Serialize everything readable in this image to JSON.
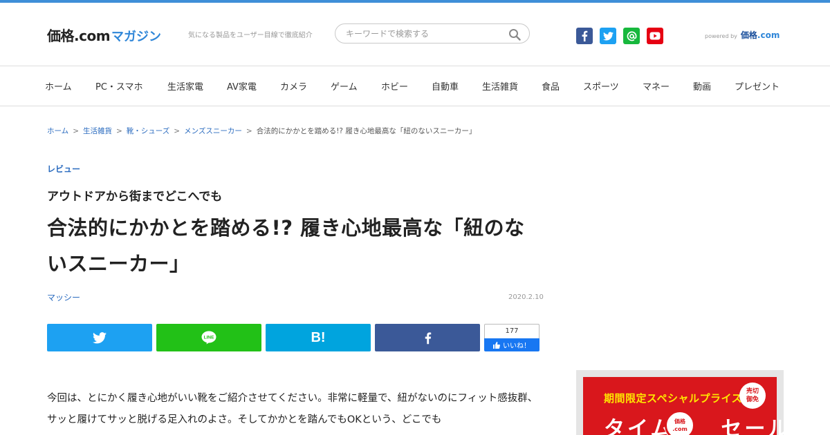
{
  "header": {
    "logo_kakaku": "価格.com",
    "logo_magazine": "マガジン",
    "tagline": "気になる製品をユーザー目線で徹底紹介",
    "search_placeholder": "キーワードで検索する",
    "powered_by": "powered by",
    "powered_logo_main": "価格",
    "powered_logo_com": ".com",
    "social_icons": [
      "facebook-icon",
      "twitter-icon",
      "at-mail-icon",
      "youtube-icon"
    ]
  },
  "nav": {
    "items": [
      "ホーム",
      "PC・スマホ",
      "生活家電",
      "AV家電",
      "カメラ",
      "ゲーム",
      "ホビー",
      "自動車",
      "生活雑貨",
      "食品",
      "スポーツ",
      "マネー",
      "動画",
      "プレゼント"
    ]
  },
  "breadcrumb": {
    "items": [
      "ホーム",
      "生活雑貨",
      "靴・シューズ",
      "メンズスニーカー"
    ],
    "separator": ">",
    "current": "合法的にかかとを踏める!? 履き心地最高な「紐のないスニーカー」"
  },
  "article": {
    "category": "レビュー",
    "subtitle": "アウトドアから街までどこへでも",
    "title": "合法的にかかとを踏める!? 履き心地最高な「紐のないスニーカー」",
    "author": "マッシー",
    "date": "2020.2.10",
    "body": "今回は、とにかく履き心地がいい靴をご紹介させてください。非常に軽量で、紐がないのにフィット感抜群、サッと履けてサッと脱げる足入れのよさ。そしてかかとを踏んでもOKという、どこでも"
  },
  "share": {
    "hatena_label": "B!",
    "like_count": "177",
    "like_label": "いいね！"
  },
  "ad": {
    "headline": "期間限定スペシャルプライス",
    "badge_line1": "売切",
    "badge_line2": "御免",
    "big_left": "タイム",
    "big_right": "セール",
    "clock_line1": "価格",
    "clock_line2": ".com"
  },
  "colors": {
    "accent": "#2f86d8",
    "link": "#2a6bbf",
    "twitter": "#1da1f2",
    "line": "#22c117",
    "hatena": "#00a4de",
    "facebook": "#3b5998",
    "youtube": "#e60012",
    "ad_red": "#d9171c"
  }
}
